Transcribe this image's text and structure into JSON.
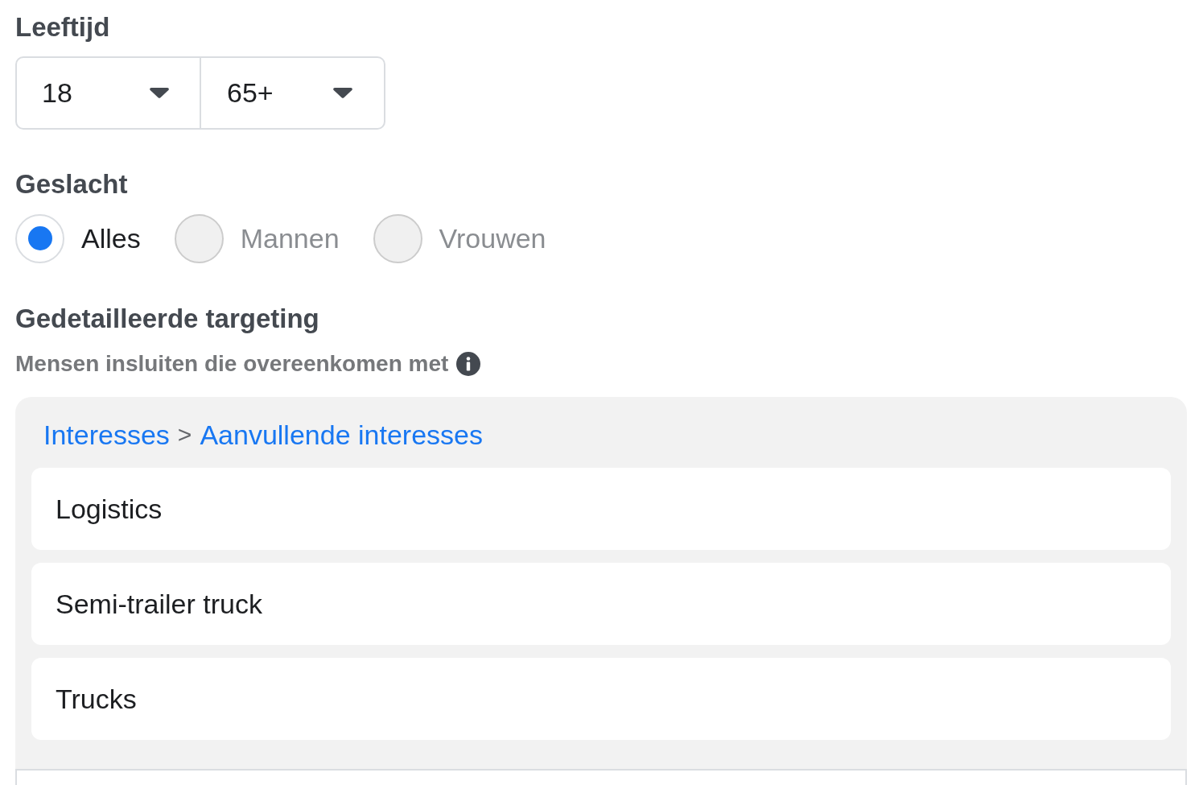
{
  "age": {
    "label": "Leeftijd",
    "dropdowns": [
      {
        "value": "18"
      },
      {
        "value": "65+"
      }
    ]
  },
  "gender": {
    "label": "Geslacht",
    "options": [
      {
        "label": "Alles",
        "selected": true
      },
      {
        "label": "Mannen",
        "selected": false
      },
      {
        "label": "Vrouwen",
        "selected": false
      }
    ]
  },
  "detailed_targeting": {
    "title": "Gedetailleerde targeting",
    "subtitle": "Mensen insluiten die overeenkomen met",
    "browse": {
      "breadcrumb": [
        "Interesses",
        "Aanvullende interesses"
      ],
      "separator": ">",
      "items": [
        "Logistics",
        "Semi-trailer truck",
        "Trucks"
      ]
    }
  }
}
